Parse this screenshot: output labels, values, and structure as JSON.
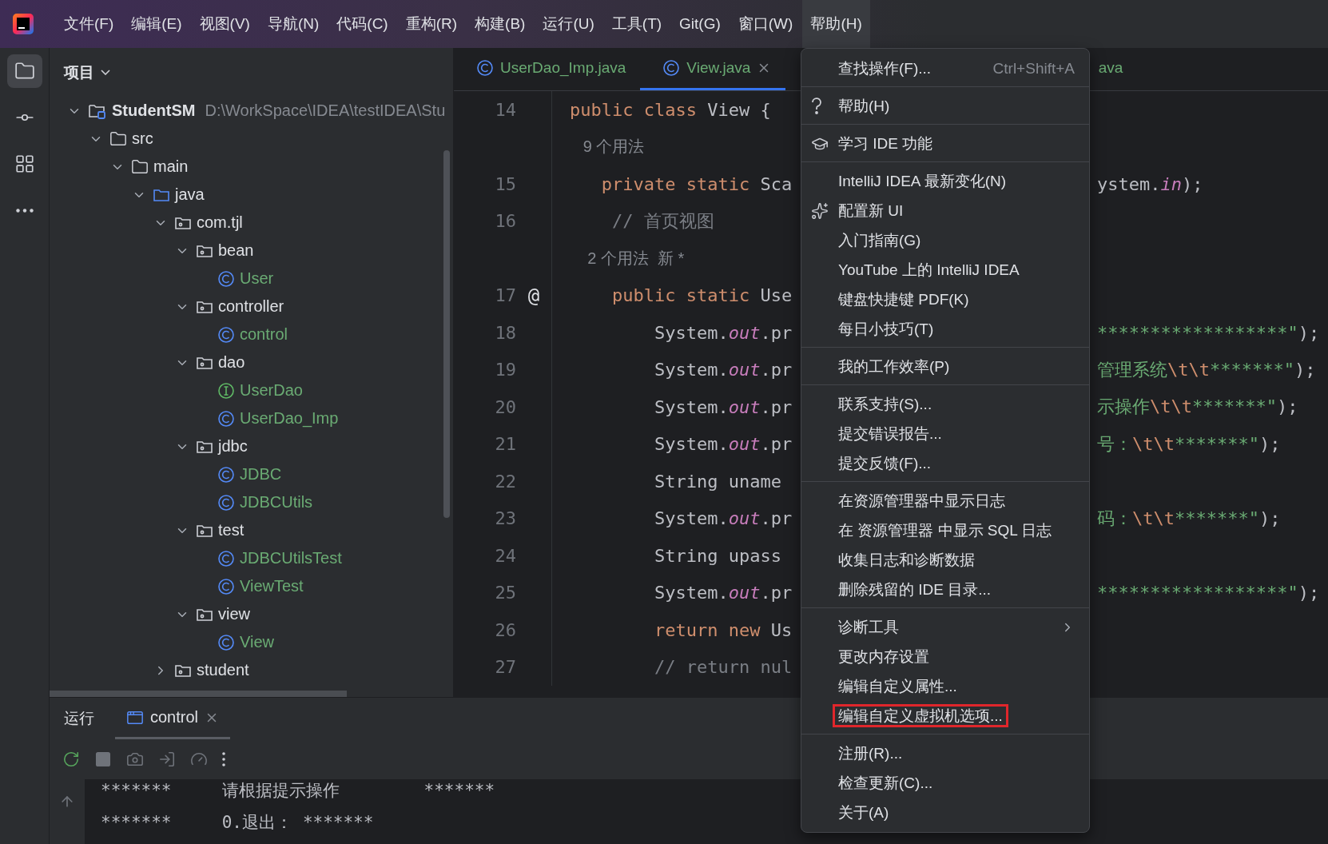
{
  "menu_bar": {
    "items": [
      {
        "label": "文件(F)",
        "selected": false
      },
      {
        "label": "编辑(E)",
        "selected": false
      },
      {
        "label": "视图(V)",
        "selected": false
      },
      {
        "label": "导航(N)",
        "selected": false
      },
      {
        "label": "代码(C)",
        "selected": false
      },
      {
        "label": "重构(R)",
        "selected": false
      },
      {
        "label": "构建(B)",
        "selected": false
      },
      {
        "label": "运行(U)",
        "selected": false
      },
      {
        "label": "工具(T)",
        "selected": false
      },
      {
        "label": "Git(G)",
        "selected": false
      },
      {
        "label": "窗口(W)",
        "selected": false
      },
      {
        "label": "帮助(H)",
        "selected": true
      }
    ]
  },
  "tool_strip": [
    {
      "kind": "project",
      "selected": true
    },
    {
      "kind": "commit",
      "selected": false
    },
    {
      "kind": "structure",
      "selected": false
    },
    {
      "kind": "more",
      "selected": false
    }
  ],
  "project_panel": {
    "title": "项目",
    "tree": [
      {
        "label": "StudentSM",
        "kind": "project",
        "path": "D:\\WorkSpace\\IDEA\\testIDEA\\Stu",
        "expanded": true,
        "children": [
          {
            "label": "src",
            "kind": "folder",
            "expanded": true,
            "children": [
              {
                "label": "main",
                "kind": "folder",
                "expanded": true,
                "children": [
                  {
                    "label": "java",
                    "kind": "source",
                    "expanded": true,
                    "children": [
                      {
                        "label": "com.tjl",
                        "kind": "package",
                        "expanded": true,
                        "children": [
                          {
                            "label": "bean",
                            "kind": "package",
                            "expanded": true,
                            "children": [
                              {
                                "label": "User",
                                "kind": "class"
                              }
                            ]
                          },
                          {
                            "label": "controller",
                            "kind": "package",
                            "expanded": true,
                            "children": [
                              {
                                "label": "control",
                                "kind": "class"
                              }
                            ]
                          },
                          {
                            "label": "dao",
                            "kind": "package",
                            "expanded": true,
                            "children": [
                              {
                                "label": "UserDao",
                                "kind": "interface"
                              },
                              {
                                "label": "UserDao_Imp",
                                "kind": "class"
                              }
                            ]
                          },
                          {
                            "label": "jdbc",
                            "kind": "package",
                            "expanded": true,
                            "children": [
                              {
                                "label": "JDBC",
                                "kind": "class"
                              },
                              {
                                "label": "JDBCUtils",
                                "kind": "class"
                              }
                            ]
                          },
                          {
                            "label": "test",
                            "kind": "package",
                            "expanded": true,
                            "children": [
                              {
                                "label": "JDBCUtilsTest",
                                "kind": "class"
                              },
                              {
                                "label": "ViewTest",
                                "kind": "class"
                              }
                            ]
                          },
                          {
                            "label": "view",
                            "kind": "package",
                            "expanded": true,
                            "children": [
                              {
                                "label": "View",
                                "kind": "class"
                              }
                            ]
                          }
                        ]
                      },
                      {
                        "label": "student",
                        "kind": "package",
                        "expanded": false
                      }
                    ]
                  }
                ]
              }
            ]
          }
        ]
      }
    ]
  },
  "editor": {
    "tabs": [
      {
        "label": "UserDao_Imp.java",
        "selected": false,
        "closable": false
      },
      {
        "label": "View.java",
        "selected": true,
        "closable": true
      },
      {
        "label": "ava",
        "selected": false,
        "closable": false
      }
    ],
    "lines": [
      {
        "number": "14",
        "left": [
          {
            "kind": "keyword",
            "text": "public class "
          },
          {
            "kind": "plain",
            "text": "View {"
          }
        ]
      },
      {
        "left": [
          {
            "kind": "hint",
            "text": "   9 个用法"
          }
        ]
      },
      {
        "number": "15",
        "left": [
          {
            "kind": "keyword",
            "text": "   private static "
          },
          {
            "kind": "plain",
            "text": "Sca"
          }
        ],
        "right": [
          {
            "kind": "plain",
            "text": "ystem."
          },
          {
            "kind": "field",
            "text": "in"
          },
          {
            "kind": "plain",
            "text": ");"
          }
        ]
      },
      {
        "number": "16",
        "left": [
          {
            "kind": "comment",
            "text": "    // 首页视图"
          }
        ]
      },
      {
        "left": [
          {
            "kind": "hint",
            "text": "    2 个用法  新 *"
          }
        ]
      },
      {
        "number": "17",
        "marker": "@",
        "left": [
          {
            "kind": "keyword",
            "text": "    public static "
          },
          {
            "kind": "plain",
            "text": "Use"
          }
        ]
      },
      {
        "number": "18",
        "left": [
          {
            "kind": "plain",
            "text": "        System."
          },
          {
            "kind": "field",
            "text": "out"
          },
          {
            "kind": "plain",
            "text": ".pr"
          }
        ],
        "right": [
          {
            "kind": "string",
            "text": "******************\""
          },
          {
            "kind": "plain",
            "text": ");"
          }
        ]
      },
      {
        "number": "19",
        "left": [
          {
            "kind": "plain",
            "text": "        System."
          },
          {
            "kind": "field",
            "text": "out"
          },
          {
            "kind": "plain",
            "text": ".pr"
          }
        ],
        "right": [
          {
            "kind": "string",
            "text": "管理系统"
          },
          {
            "kind": "escape",
            "text": "\\t\\t"
          },
          {
            "kind": "string",
            "text": "*******\""
          },
          {
            "kind": "plain",
            "text": ");"
          }
        ]
      },
      {
        "number": "20",
        "left": [
          {
            "kind": "plain",
            "text": "        System."
          },
          {
            "kind": "field",
            "text": "out"
          },
          {
            "kind": "plain",
            "text": ".pr"
          }
        ],
        "right": [
          {
            "kind": "string",
            "text": "示操作"
          },
          {
            "kind": "escape",
            "text": "\\t\\t"
          },
          {
            "kind": "string",
            "text": "*******\""
          },
          {
            "kind": "plain",
            "text": ");"
          }
        ]
      },
      {
        "number": "21",
        "left": [
          {
            "kind": "plain",
            "text": "        System."
          },
          {
            "kind": "field",
            "text": "out"
          },
          {
            "kind": "plain",
            "text": ".pr"
          }
        ],
        "right": [
          {
            "kind": "string",
            "text": "号："
          },
          {
            "kind": "escape",
            "text": "\\t\\t"
          },
          {
            "kind": "string",
            "text": "*******\""
          },
          {
            "kind": "plain",
            "text": ");"
          }
        ]
      },
      {
        "number": "22",
        "left": [
          {
            "kind": "plain",
            "text": "        String uname"
          }
        ]
      },
      {
        "number": "23",
        "left": [
          {
            "kind": "plain",
            "text": "        System."
          },
          {
            "kind": "field",
            "text": "out"
          },
          {
            "kind": "plain",
            "text": ".pr"
          }
        ],
        "right": [
          {
            "kind": "string",
            "text": "码："
          },
          {
            "kind": "escape",
            "text": "\\t\\t"
          },
          {
            "kind": "string",
            "text": "*******\""
          },
          {
            "kind": "plain",
            "text": ");"
          }
        ]
      },
      {
        "number": "24",
        "left": [
          {
            "kind": "plain",
            "text": "        String upass"
          }
        ]
      },
      {
        "number": "25",
        "left": [
          {
            "kind": "plain",
            "text": "        System."
          },
          {
            "kind": "field",
            "text": "out"
          },
          {
            "kind": "plain",
            "text": ".pr"
          }
        ],
        "right": [
          {
            "kind": "string",
            "text": "******************\""
          },
          {
            "kind": "plain",
            "text": ");"
          }
        ]
      },
      {
        "number": "26",
        "left": [
          {
            "kind": "keyword",
            "text": "        return new "
          },
          {
            "kind": "plain",
            "text": "Us"
          }
        ]
      },
      {
        "number": "27",
        "left": [
          {
            "kind": "comment",
            "text": "        // return nul"
          }
        ]
      }
    ]
  },
  "help_menu": {
    "groups": [
      [
        {
          "label": "查找操作(F)...",
          "shortcut": "Ctrl+Shift+A",
          "kind": "action",
          "marked": false
        }
      ],
      [
        {
          "label": "帮助(H)",
          "kind": "help",
          "marked": false
        }
      ],
      [
        {
          "label": "学习 IDE 功能",
          "kind": "learn",
          "marked": false
        }
      ],
      [
        {
          "label": "IntelliJ IDEA 最新变化(N)",
          "kind": "action",
          "marked": false
        },
        {
          "label": "配置新 UI",
          "kind": "new_ui",
          "marked": false
        },
        {
          "label": "入门指南(G)",
          "kind": "action",
          "marked": false
        },
        {
          "label": "YouTube 上的 IntelliJ IDEA",
          "kind": "action",
          "marked": false
        },
        {
          "label": "键盘快捷键 PDF(K)",
          "kind": "action",
          "marked": false
        },
        {
          "label": "每日小技巧(T)",
          "kind": "action",
          "marked": false
        }
      ],
      [
        {
          "label": "我的工作效率(P)",
          "kind": "action",
          "marked": false
        }
      ],
      [
        {
          "label": "联系支持(S)...",
          "kind": "action",
          "marked": false
        },
        {
          "label": "提交错误报告...",
          "kind": "action",
          "marked": false
        },
        {
          "label": "提交反馈(F)...",
          "kind": "action",
          "marked": false
        }
      ],
      [
        {
          "label": "在资源管理器中显示日志",
          "kind": "action",
          "marked": false
        },
        {
          "label": "在 资源管理器 中显示 SQL 日志",
          "kind": "action",
          "marked": false
        },
        {
          "label": "收集日志和诊断数据",
          "kind": "action",
          "marked": false
        },
        {
          "label": "删除残留的 IDE 目录...",
          "kind": "action",
          "marked": false
        }
      ],
      [
        {
          "label": "诊断工具",
          "kind": "submenu",
          "marked": false
        },
        {
          "label": "更改内存设置",
          "kind": "action",
          "marked": false
        },
        {
          "label": "编辑自定义属性...",
          "kind": "action",
          "marked": false
        },
        {
          "label": "编辑自定义虚拟机选项...",
          "kind": "action",
          "marked": true
        }
      ],
      [
        {
          "label": "注册(R)...",
          "kind": "action",
          "marked": false
        },
        {
          "label": "检查更新(C)...",
          "kind": "action",
          "marked": false
        },
        {
          "label": "关于(A)",
          "kind": "action",
          "marked": false
        }
      ]
    ]
  },
  "run_panel": {
    "title": "运行",
    "tabs": [
      {
        "label": "control",
        "selected": true
      }
    ],
    "toolbar": [
      {
        "kind": "rerun",
        "disabled": false
      },
      {
        "kind": "stop",
        "disabled": true
      },
      {
        "kind": "camera",
        "disabled": true
      },
      {
        "kind": "import",
        "disabled": true
      },
      {
        "kind": "gauge",
        "disabled": true
      },
      {
        "kind": "more",
        "disabled": false
      }
    ],
    "console": [
      "*******\t\t请根据提示操作\t\t*******",
      "*******\t\t0.退出：\t*******"
    ]
  }
}
